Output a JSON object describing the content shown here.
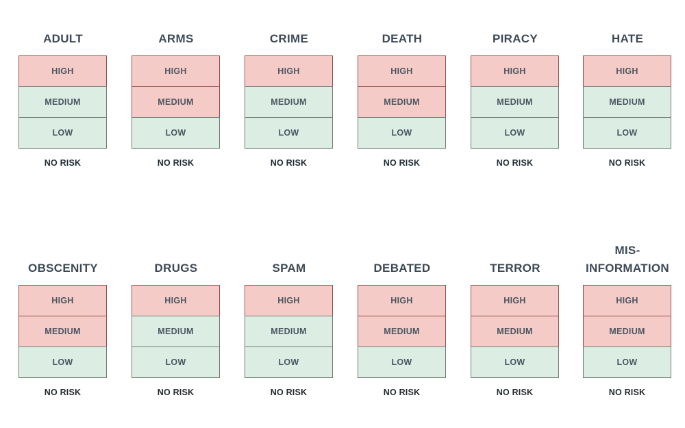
{
  "legend": {
    "high_color": "#f4cbc7",
    "low_color": "#dcede4",
    "no_risk_label": "NO RISK"
  },
  "levels": [
    "HIGH",
    "MEDIUM",
    "LOW"
  ],
  "categories": [
    {
      "name": "ADULT",
      "flagged": [
        "HIGH"
      ]
    },
    {
      "name": "ARMS",
      "flagged": [
        "HIGH",
        "MEDIUM"
      ]
    },
    {
      "name": "CRIME",
      "flagged": [
        "HIGH"
      ]
    },
    {
      "name": "DEATH",
      "flagged": [
        "HIGH",
        "MEDIUM"
      ]
    },
    {
      "name": "PIRACY",
      "flagged": [
        "HIGH"
      ]
    },
    {
      "name": "HATE",
      "flagged": [
        "HIGH"
      ]
    },
    {
      "name": "OBSCENITY",
      "flagged": [
        "HIGH",
        "MEDIUM"
      ]
    },
    {
      "name": "DRUGS",
      "flagged": [
        "HIGH"
      ]
    },
    {
      "name": "SPAM",
      "flagged": [
        "HIGH"
      ]
    },
    {
      "name": "DEBATED",
      "flagged": [
        "HIGH",
        "MEDIUM"
      ]
    },
    {
      "name": "TERROR",
      "flagged": [
        "HIGH",
        "MEDIUM"
      ]
    },
    {
      "name": "MIS-\nINFORMATION",
      "flagged": [
        "HIGH",
        "MEDIUM"
      ]
    }
  ]
}
